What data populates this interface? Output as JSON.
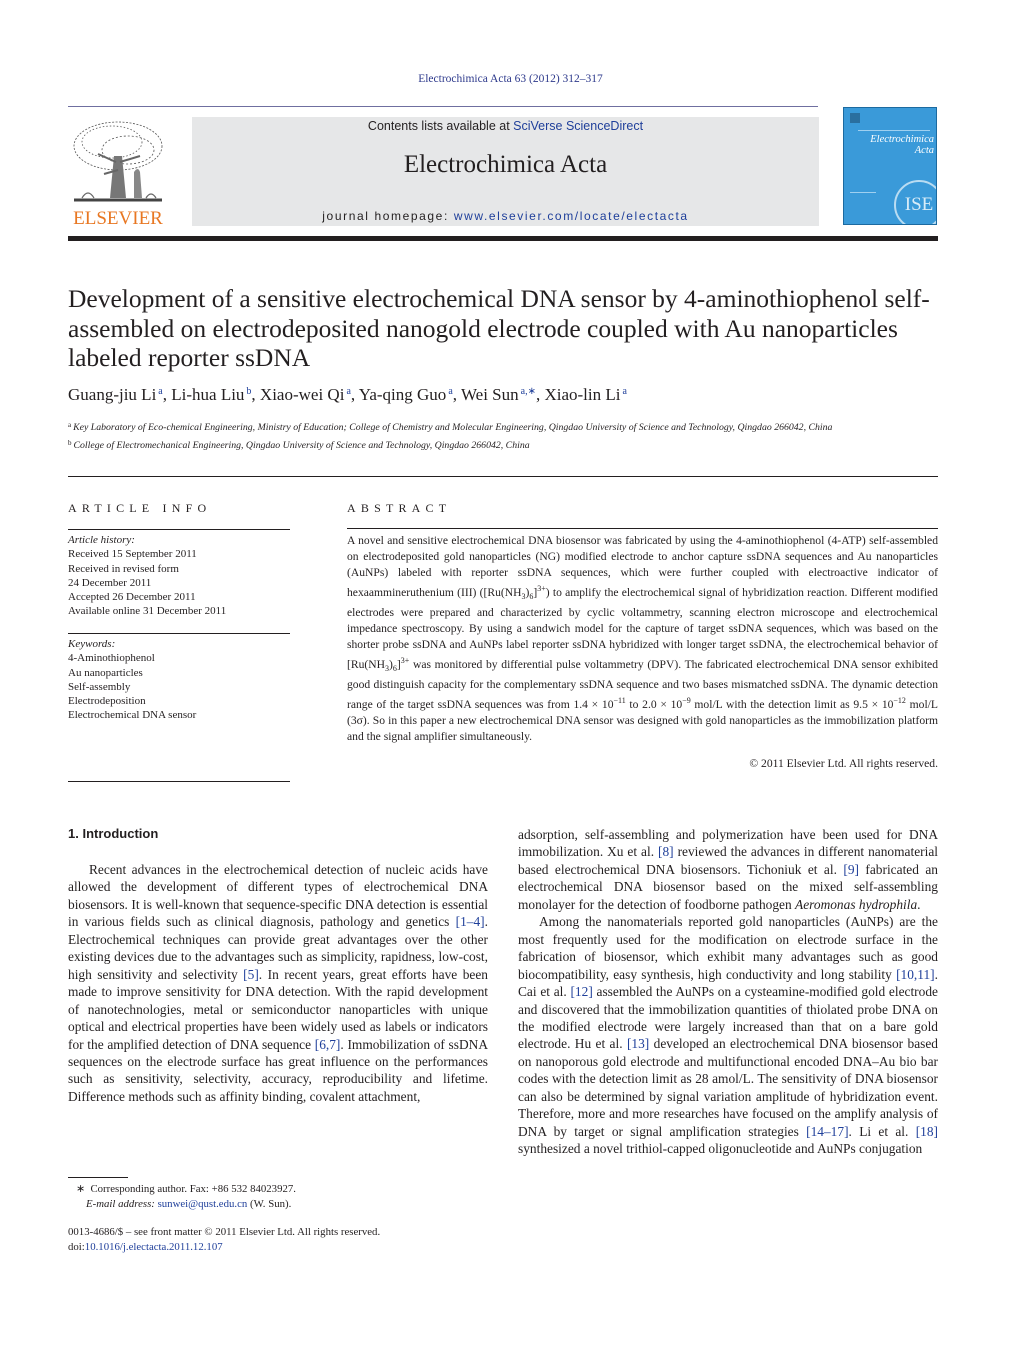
{
  "header": {
    "citation": "Electrochimica Acta 63 (2012) 312–317",
    "contents_prefix": "Contents lists available at ",
    "contents_link": "SciVerse ScienceDirect",
    "journal_title": "Electrochimica Acta",
    "homepage_prefix": "journal homepage: ",
    "homepage_link": "www.elsevier.com/locate/electacta",
    "publisher_logo_text": "ELSEVIER",
    "cover": {
      "title_line1": "Electrochimica",
      "title_line2": "Acta",
      "badge": "ISE",
      "color": "#3a9ad9"
    },
    "colors": {
      "link": "#1f3f9a",
      "elsevier_orange": "#e87722",
      "masthead_bg": "#e6e7e8"
    }
  },
  "article": {
    "title": "Development of a sensitive electrochemical DNA sensor by 4-aminothiophenol self-assembled on electrodeposited nanogold electrode coupled with Au nanoparticles labeled reporter ssDNA",
    "authors": [
      {
        "name": "Guang-jiu Li",
        "aff": "a"
      },
      {
        "name": "Li-hua Liu",
        "aff": "b"
      },
      {
        "name": "Xiao-wei Qi",
        "aff": "a"
      },
      {
        "name": "Ya-qing Guo",
        "aff": "a"
      },
      {
        "name": "Wei Sun",
        "aff": "a,∗"
      },
      {
        "name": "Xiao-lin Li",
        "aff": "a"
      }
    ],
    "affiliations": [
      {
        "key": "a",
        "text": "Key Laboratory of Eco-chemical Engineering, Ministry of Education; College of Chemistry and Molecular Engineering, Qingdao University of Science and Technology, Qingdao 266042, China"
      },
      {
        "key": "b",
        "text": "College of Electromechanical Engineering, Qingdao University of Science and Technology, Qingdao 266042, China"
      }
    ]
  },
  "article_info": {
    "heading": "ARTICLE INFO",
    "history_label": "Article history:",
    "history": [
      "Received 15 September 2011",
      "Received in revised form",
      "24 December 2011",
      "Accepted 26 December 2011",
      "Available online 31 December 2011"
    ],
    "keywords_label": "Keywords:",
    "keywords": [
      "4-Aminothiophenol",
      "Au nanoparticles",
      "Self-assembly",
      "Electrodeposition",
      "Electrochemical DNA sensor"
    ]
  },
  "abstract": {
    "heading": "ABSTRACT",
    "p1": "A novel and sensitive electrochemical DNA biosensor was fabricated by using the 4-aminothiophenol (4-ATP) self-assembled on electrodeposited gold nanoparticles (NG) modified electrode to anchor capture ssDNA sequences and Au nanoparticles (AuNPs) labeled with reporter ssDNA sequences, which were further coupled with electroactive indicator of hexaammineruthenium (III) ([Ru(NH",
    "p2": ")",
    "p3": "]",
    "p4": ") to amplify the electrochemical signal of hybridization reaction. Different modified electrodes were prepared and characterized by cyclic voltammetry, scanning electron microscope and electrochemical impedance spectroscopy. By using a sandwich model for the capture of target ssDNA sequences, which was based on the shorter probe ssDNA and AuNPs label reporter ssDNA hybridized with longer target ssDNA, the electrochemical behavior of [Ru(NH",
    "p5": ")",
    "p6": "]",
    "p7": " was monitored by differential pulse voltammetry (DPV). The fabricated electrochemical DNA sensor exhibited good distinguish capacity for the complementary ssDNA sequence and two bases mismatched ssDNA. The dynamic detection range of the target ssDNA sequences was from 1.4 × 10",
    "p8": " to 2.0 × 10",
    "p9": " mol/L with the detection limit as 9.5 × 10",
    "p10": " mol/L (3σ). So in this paper a new electrochemical DNA sensor was designed with gold nanoparticles as the immobilization platform and the signal amplifier simultaneously.",
    "sub3": "3",
    "sub6": "6",
    "sup3plus": "3+",
    "exp1": "−11",
    "exp2": "−9",
    "exp3": "−12",
    "copyright": "© 2011 Elsevier Ltd. All rights reserved."
  },
  "body": {
    "section_heading": "1.  Introduction",
    "left": {
      "t1": "Recent advances in the electrochemical detection of nucleic acids have allowed the development of different types of electrochemical DNA biosensors. It is well-known that sequence-specific DNA detection is essential in various fields such as clinical diagnosis, pathology and genetics ",
      "r1": "[1–4]",
      "t2": ". Electrochemical techniques can provide great advantages over the other existing devices due to the advantages such as simplicity, rapidness, low-cost, high sensitivity and selectivity ",
      "r2": "[5]",
      "t3": ". In recent years, great efforts have been made to improve sensitivity for DNA detection. With the rapid development of nanotechnologies, metal or semiconductor nanoparticles with unique optical and electrical properties have been widely used as labels or indicators for the amplified detection of DNA sequence ",
      "r3": "[6,7]",
      "t4": ". Immobilization of ssDNA sequences on the electrode surface has great influence on the performances such as sensitivity, selectivity, accuracy, reproducibility and lifetime. Difference methods such as affinity binding, covalent attachment,"
    },
    "right": {
      "t1": "adsorption, self-assembling and polymerization have been used for DNA immobilization. Xu et al. ",
      "r1": "[8]",
      "t2": " reviewed the advances in different nanomaterial based electrochemical DNA biosensors. Tichoniuk et al. ",
      "r2": "[9]",
      "t3": " fabricated an electrochemical DNA biosensor based on the mixed self-assembling monolayer for the detection of foodborne pathogen ",
      "species": "Aeromonas hydrophila",
      "t4": ".",
      "p2_t1": "Among the nanomaterials reported gold nanoparticles (AuNPs) are the most frequently used for the modification on electrode surface in the fabrication of biosensor, which exhibit many advantages such as good biocompatibility, easy synthesis, high conductivity and long stability ",
      "p2_r1": "[10,11]",
      "p2_t2": ". Cai et al. ",
      "p2_r2": "[12]",
      "p2_t3": " assembled the AuNPs on a cysteamine-modified gold electrode and discovered that the immobilization quantities of thiolated probe DNA on the modified electrode were largely increased than that on a bare gold electrode. Hu et al. ",
      "p2_r3": "[13]",
      "p2_t4": " developed an electrochemical DNA biosensor based on nanoporous gold electrode and multifunctional encoded DNA–Au bio bar codes with the detection limit as 28 amol/L. The sensitivity of DNA biosensor can also be determined by signal variation amplitude of hybridization event. Therefore, more and more researches have focused on the amplify analysis of DNA by target or signal amplification strategies ",
      "p2_r4": "[14–17]",
      "p2_t5": ". Li et al. ",
      "p2_r5": "[18]",
      "p2_t6": " synthesized a novel trithiol-capped oligonucleotide and AuNPs conjugation"
    }
  },
  "footnotes": {
    "star": "∗",
    "corresponding": "Corresponding author. Fax: +86 532 84023927.",
    "email_label": "E-mail address: ",
    "email": "sunwei@qust.edu.cn",
    "email_suffix": " (W. Sun).",
    "front_matter": "0013-4686/$ – see front matter © 2011 Elsevier Ltd. All rights reserved.",
    "doi_prefix": "doi:",
    "doi": "10.1016/j.electacta.2011.12.107"
  }
}
